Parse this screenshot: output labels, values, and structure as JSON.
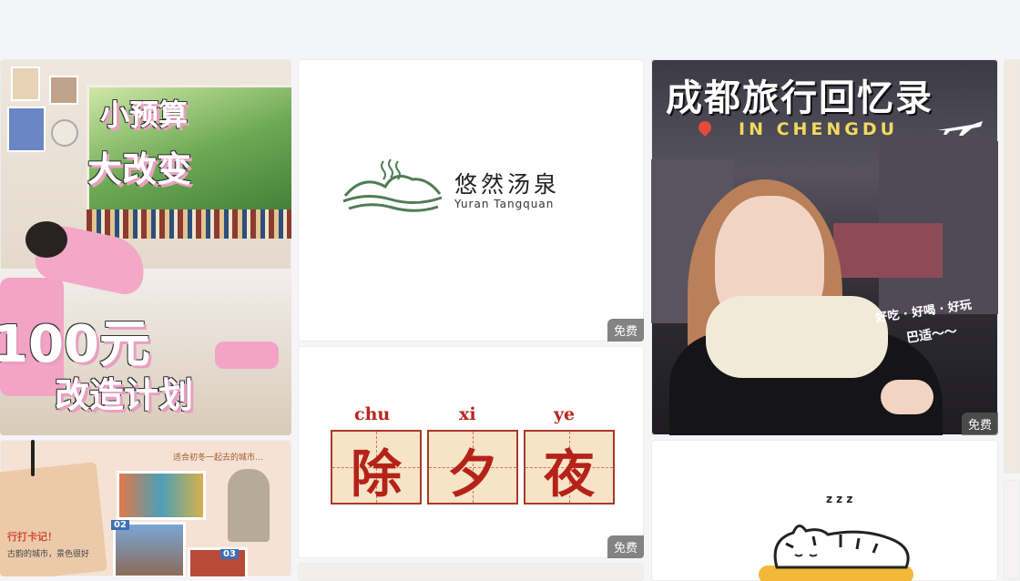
{
  "cards": {
    "room": {
      "line1": "小预算",
      "line2": "大改变",
      "line3": "100元",
      "line4": "改造计划"
    },
    "logo": {
      "name_cn": "悠然汤泉",
      "name_en": "Yuran Tangquan",
      "badge": "免费",
      "accent": "#4f7d55"
    },
    "chengdu": {
      "title": "成都旅行回忆录",
      "subtitle": "IN CHENGDU",
      "tag1": "好吃 · 好喝 · 好玩",
      "tag2": "巴适～～",
      "badge": "免费"
    },
    "travel": {
      "note": "适合初冬一起去的城市…",
      "hand1": "行打卡记！",
      "hand2": "古韵的城市，景色很好",
      "num1": "02",
      "num2": "03"
    },
    "chuxiye": {
      "pinyin": [
        "chu",
        "xi",
        "ye"
      ],
      "chars": [
        "除",
        "夕",
        "夜"
      ],
      "badge": "免费",
      "color": "#b52219"
    },
    "cat": {
      "zzz": "z z z"
    }
  }
}
